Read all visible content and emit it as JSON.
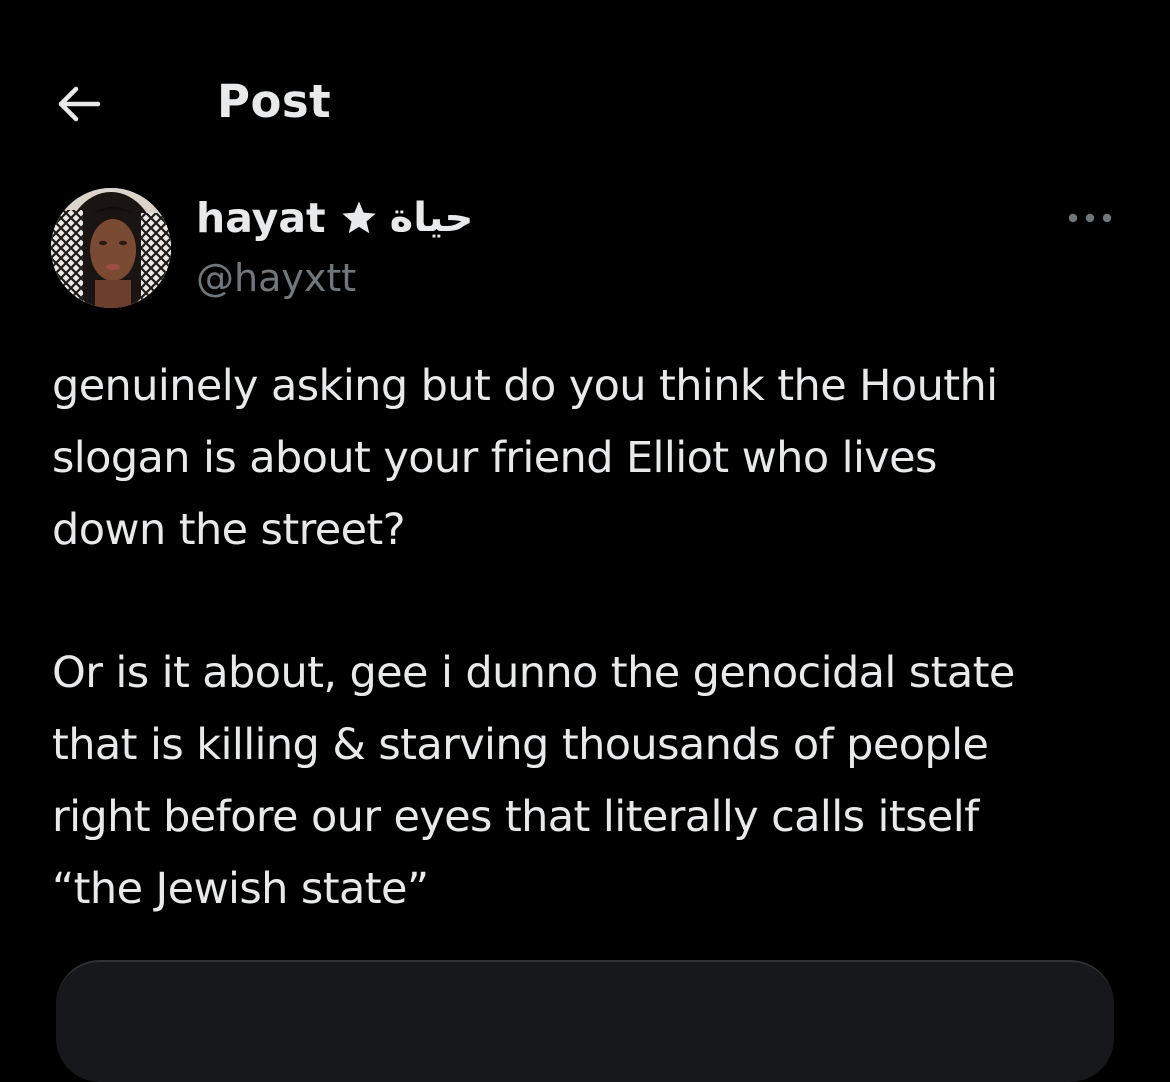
{
  "header": {
    "back_icon": "arrow-left-icon",
    "title": "Post"
  },
  "author": {
    "display_name": "hayat",
    "star_icon": "star-icon",
    "arabic_name": "حياة",
    "handle": "@hayxtt",
    "avatar": "avatar-photo"
  },
  "more_icon": "more-horizontal-icon",
  "post": {
    "paragraph1_lines": [
      "genuinely asking but do you think the Houthi",
      "slogan is about your friend Elliot who lives",
      "down the street?"
    ],
    "paragraph2_lines": [
      "Or is it about, gee i dunno the genocidal state",
      "that is killing & starving thousands of people",
      "right before our eyes that literally calls itself",
      "“the Jewish state”"
    ]
  },
  "colors": {
    "background": "#000000",
    "primary_text": "#e7e9ea",
    "secondary_text": "#71767b"
  }
}
